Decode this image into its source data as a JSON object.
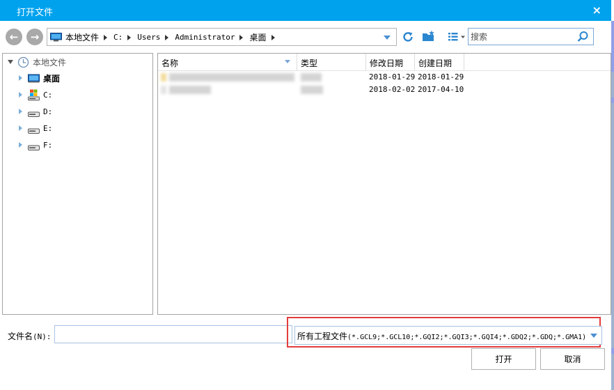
{
  "window": {
    "title": "打开文件",
    "close_glyph": "×"
  },
  "nav": {
    "back_glyph": "←",
    "forward_glyph": "→",
    "breadcrumbs": [
      "本地文件",
      "C:",
      "Users",
      "Administrator",
      "桌面"
    ],
    "search_placeholder": "搜索"
  },
  "tree": {
    "root_label": "本地文件",
    "items": [
      {
        "label": "桌面",
        "icon": "desktop-icon"
      },
      {
        "label": "C:",
        "icon": "windows-drive-icon"
      },
      {
        "label": "D:",
        "icon": "drive-icon"
      },
      {
        "label": "E:",
        "icon": "drive-icon"
      },
      {
        "label": "F:",
        "icon": "drive-icon"
      }
    ]
  },
  "files": {
    "columns": [
      "名称",
      "类型",
      "修改日期",
      "创建日期"
    ],
    "rows": [
      {
        "modified": "2018-01-29",
        "created": "2018-01-29"
      },
      {
        "modified": "2018-02-02",
        "created": "2017-04-10"
      }
    ]
  },
  "footer": {
    "filename_label": "文件名",
    "filename_shortcut": "(N):",
    "filename_value": "",
    "filter_prefix": "所有工程文件",
    "filter_patterns": "(*.GCL9;*.GCL10;*.GQI2;*.GQI3;*.GQI4;*.GDQ2;*.GDQ;*.GMA1)",
    "open_button": "打开",
    "cancel_button": "取消"
  },
  "colors": {
    "titlebar": "#00a2ee",
    "highlight_box": "#e23c3c",
    "accent": "#4a8fd2"
  }
}
